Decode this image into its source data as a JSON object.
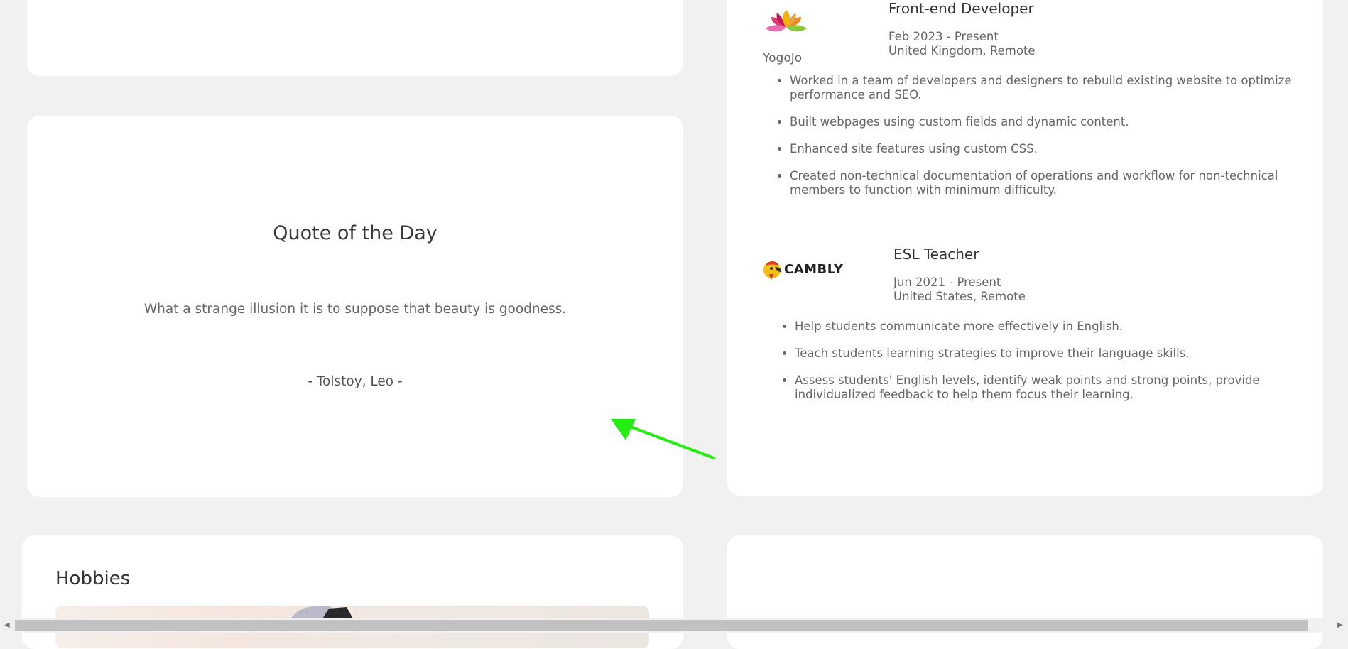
{
  "quote_card": {
    "title": "Quote of the Day",
    "text": "What a strange illusion it is to suppose that beauty is goodness.",
    "author": "- Tolstoy, Leo -"
  },
  "experience": {
    "jobs": [
      {
        "logo_icon": "yogojo-lotus-logo",
        "logo_text": "YogoJo",
        "title": "Front-end Developer",
        "dates": "Feb 2023 - Present",
        "location": "United Kingdom, Remote",
        "bullets": [
          "Worked in a team of developers and designers to rebuild existing website to optimize performance and SEO.",
          "Built webpages using custom fields and dynamic content.",
          "Enhanced site features using custom CSS.",
          "Created non-technical documentation of operations and workflow for non-technical members to function with minimum difficulty."
        ]
      },
      {
        "logo_icon": "cambly-parrot-logo",
        "logo_text": "CAMBLY",
        "title": "ESL Teacher",
        "dates": "Jun 2021 - Present",
        "location": "United States, Remote",
        "bullets": [
          "Help students communicate more effectively in English.",
          "Teach students learning strategies to improve their language skills.",
          "Assess students' English levels, identify weak points and strong points, provide individualized feedback to help them focus their learning."
        ]
      }
    ]
  },
  "hobbies": {
    "title": "Hobbies"
  },
  "annotation": {
    "arrow_color": "#22ee11",
    "arrow_icon": "pointer-arrow-icon"
  },
  "scrollbar": {
    "left_arrow": "◀",
    "right_arrow": "▶"
  }
}
